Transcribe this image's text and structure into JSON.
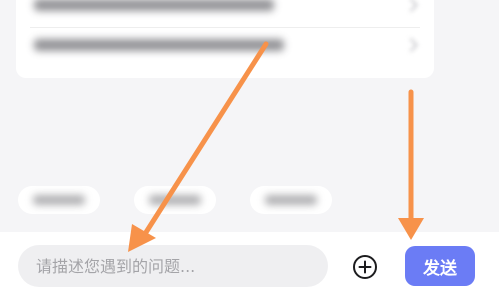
{
  "faq_card": {
    "rows": [
      {
        "text": ""
      },
      {
        "text": ""
      }
    ]
  },
  "chips": [
    {
      "label": ""
    },
    {
      "label": ""
    },
    {
      "label": ""
    }
  ],
  "composer": {
    "input_placeholder": "请描述您遇到的问题...",
    "input_value": "",
    "add_icon": "plus-circle-icon",
    "send_label": "发送",
    "send_color": "#6b7cf5"
  },
  "annotations": {
    "arrow_color": "#f7924a"
  }
}
